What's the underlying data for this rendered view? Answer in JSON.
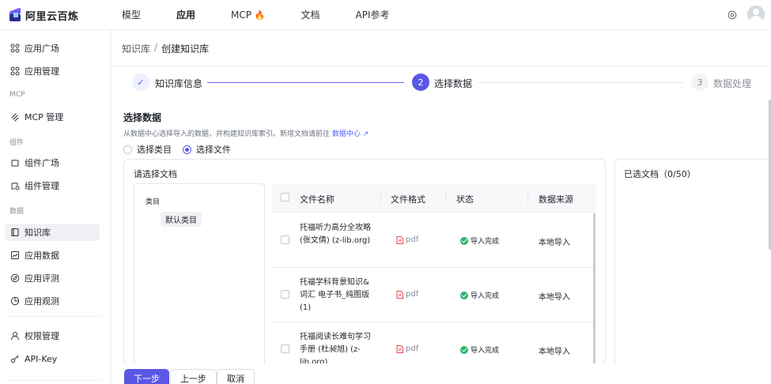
{
  "brand": {
    "name": "阿里云百炼"
  },
  "topnav": [
    {
      "label": "模型",
      "active": false
    },
    {
      "label": "应用",
      "active": true
    },
    {
      "label": "MCP",
      "active": false,
      "badge": "🔥"
    },
    {
      "label": "文档",
      "active": false
    },
    {
      "label": "API参考",
      "active": false
    }
  ],
  "sidebar": {
    "items": [
      {
        "label": "应用广场",
        "icon": "grid-icon"
      },
      {
        "label": "应用管理",
        "icon": "grid-icon"
      },
      {
        "label": "MCP 管理",
        "icon": "mcp-icon"
      },
      {
        "label": "组件广场",
        "icon": "puzzle-icon"
      },
      {
        "label": "组件管理",
        "icon": "puzzle-settings-icon"
      },
      {
        "label": "知识库",
        "icon": "book-icon",
        "active": true
      },
      {
        "label": "应用数据",
        "icon": "chart-icon"
      },
      {
        "label": "应用评测",
        "icon": "compass-icon"
      },
      {
        "label": "应用观测",
        "icon": "pie-icon"
      },
      {
        "label": "权限管理",
        "icon": "user-icon"
      },
      {
        "label": "API-Key",
        "icon": "key-icon"
      }
    ],
    "groups": {
      "mcp": "MCP",
      "components": "组件",
      "data": "数据"
    }
  },
  "breadcrumb": {
    "parent": "知识库",
    "separator": "/",
    "current": "创建知识库"
  },
  "steps": [
    {
      "index": "✓",
      "label": "知识库信息",
      "state": "done"
    },
    {
      "index": "2",
      "label": "选择数据",
      "state": "current"
    },
    {
      "index": "3",
      "label": "数据处理",
      "state": "todo"
    }
  ],
  "section": {
    "title": "选择数据",
    "desc": "从数据中心选择导入的数据，并构建知识库索引。新增文档请前往",
    "link": "数据中心",
    "radios": [
      {
        "label": "选择类目",
        "checked": false
      },
      {
        "label": "选择文件",
        "checked": true
      }
    ]
  },
  "doc_panel": {
    "title": "请选择文档",
    "category_header": "类目",
    "category_tag": "默认类目",
    "columns": [
      "文件名称",
      "文件格式",
      "状态",
      "数据来源"
    ],
    "rows": [
      {
        "name": "托福听力高分全攻略 (张文倩) (z-lib.org)",
        "format": "pdf",
        "status": "导入完成",
        "source": "本地导入"
      },
      {
        "name": "托福学科背景知识&词汇 电子书_纯图版 (1)",
        "format": "pdf",
        "status": "导入完成",
        "source": "本地导入"
      },
      {
        "name": "托福阅读长难句学习手册 (杜昶旭) (z-lib.org)",
        "format": "pdf",
        "status": "导入完成",
        "source": "本地导入"
      }
    ]
  },
  "selected_panel": {
    "title": "已选文档（0/50）"
  },
  "footer": {
    "next": "下一步",
    "prev": "上一步",
    "cancel": "取消"
  },
  "colors": {
    "accent": "#5b57e6",
    "success": "#2bb56b",
    "pdf": "#e5484d"
  }
}
